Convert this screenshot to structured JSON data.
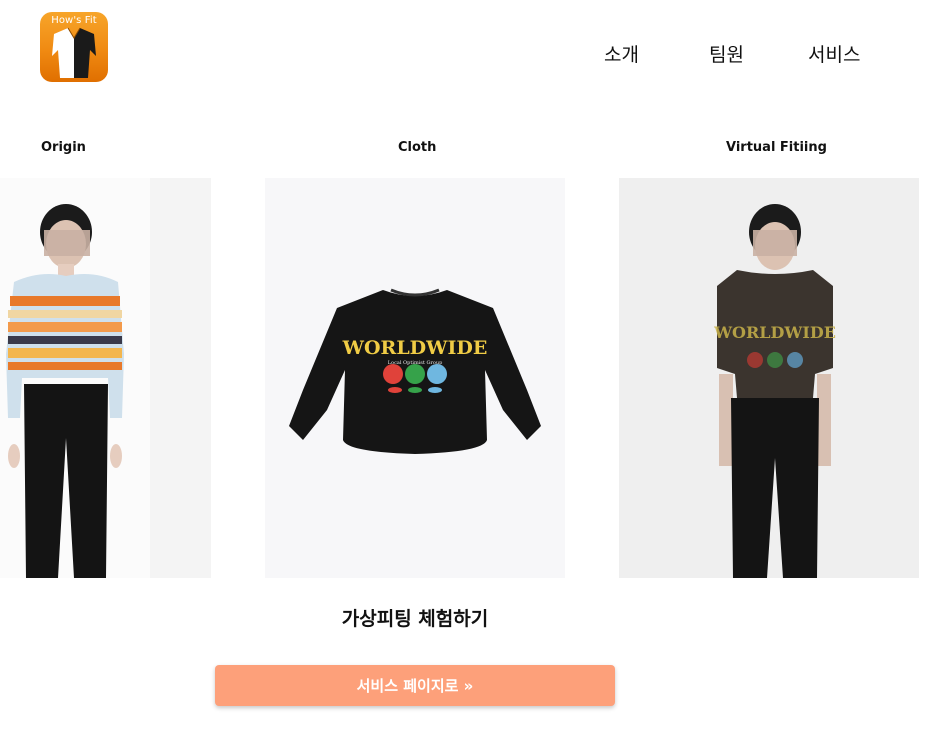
{
  "header": {
    "logo_text": "How's Fit",
    "nav": [
      {
        "label": "소개"
      },
      {
        "label": "팀원"
      },
      {
        "label": "서비스"
      }
    ]
  },
  "gallery": {
    "columns": [
      {
        "title": "Origin"
      },
      {
        "title": "Cloth"
      },
      {
        "title": "Virtual Fitiing"
      }
    ],
    "cloth_print": {
      "headline": "WORLDWIDE",
      "subline": "Local Optimist Group"
    }
  },
  "cta_section": {
    "title": "가상피팅 체험하기",
    "button_label": "서비스 페이지로 »"
  },
  "colors": {
    "accent": "#fda07a",
    "logo_orange": "#f08a12",
    "text": "#111111"
  },
  "icons": [
    "coat-logo-icon"
  ]
}
